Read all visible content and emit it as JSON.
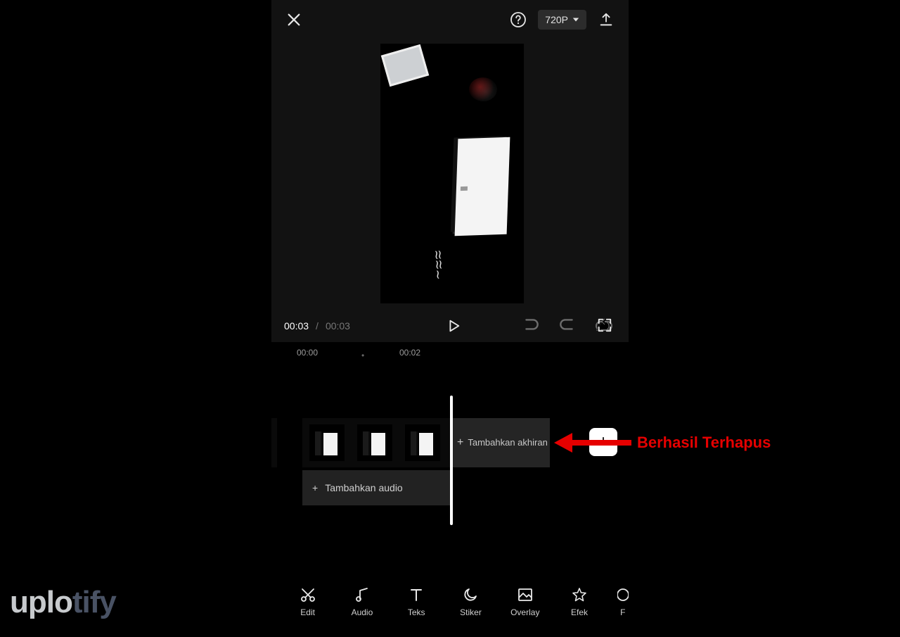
{
  "topbar": {
    "resolution_label": "720P"
  },
  "playback": {
    "current_time": "00:03",
    "separator": "/",
    "total_time": "00:03"
  },
  "ruler": {
    "t0": "00:00",
    "tick": "•",
    "t2": "00:02"
  },
  "timeline": {
    "add_ending_label": "Tambahkan akhiran",
    "add_ending_plus": "+",
    "add_media_plus": "+",
    "add_audio_plus": "+",
    "add_audio_label": "Tambahkan audio"
  },
  "tooltabs": {
    "edit": "Edit",
    "audio": "Audio",
    "teks": "Teks",
    "stiker": "Stiker",
    "overlay": "Overlay",
    "efek": "Efek",
    "cut": "F"
  },
  "annotation": {
    "text": "Berhasil Terhapus"
  },
  "watermark": {
    "part_a": "uplo",
    "part_b": "tify"
  },
  "icons": {
    "close": "close-icon",
    "help": "help-icon",
    "export": "export-icon",
    "chevron_down": "chevron-down-icon",
    "play": "play-icon",
    "undo": "undo-icon",
    "redo": "redo-icon",
    "fullscreen": "fullscreen-icon",
    "scissors": "scissors-icon",
    "music": "music-icon",
    "text": "text-icon",
    "moon": "moon-icon",
    "image": "image-icon",
    "star": "star-icon"
  }
}
